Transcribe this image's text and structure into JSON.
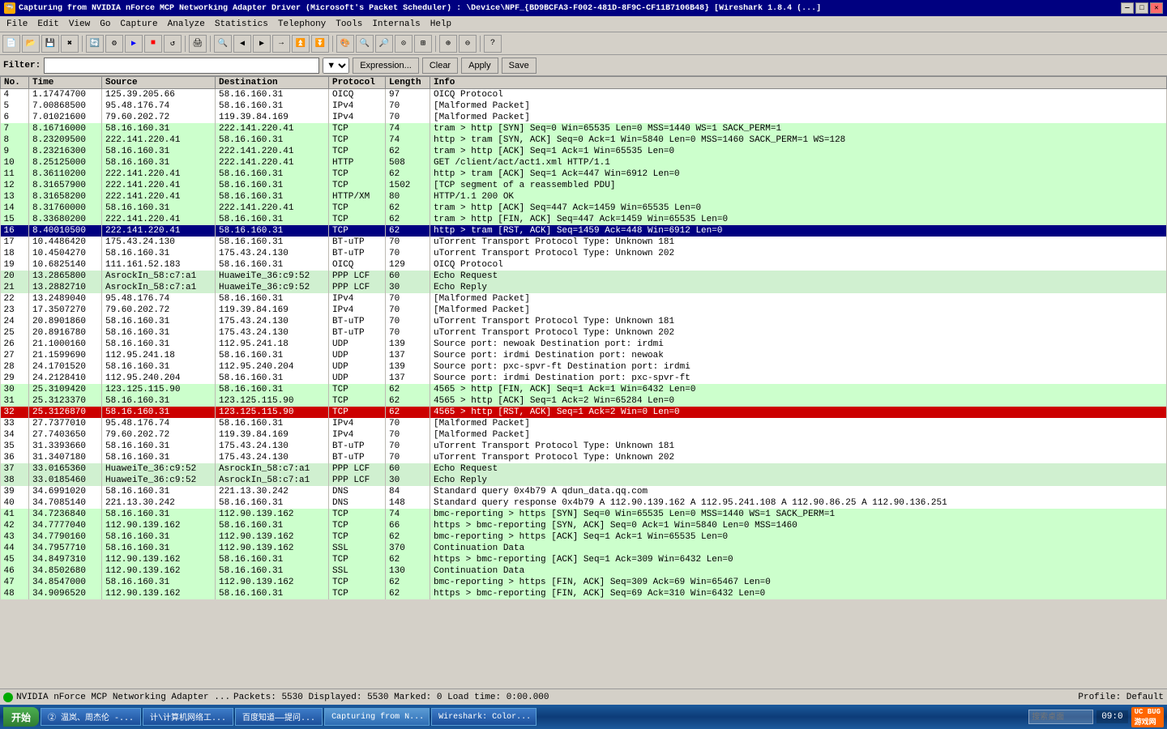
{
  "titlebar": {
    "title": "Capturing from NVIDIA nForce MCP Networking Adapter Driver (Microsoft's Packet Scheduler) : \\Device\\NPF_{BD9BCFA3-F002-481D-8F9C-CF11B7106B48}  [Wireshark 1.8.4 (...]",
    "icon": "🦈",
    "btn_min": "—",
    "btn_max": "□",
    "btn_close": "✕"
  },
  "menubar": {
    "items": [
      "File",
      "Edit",
      "View",
      "Go",
      "Capture",
      "Analyze",
      "Statistics",
      "Telephony",
      "Tools",
      "Internals",
      "Help"
    ]
  },
  "filterbar": {
    "label": "Filter:",
    "placeholder": "",
    "expression_btn": "Expression...",
    "clear_btn": "Clear",
    "apply_btn": "Apply",
    "save_btn": "Save"
  },
  "columns": [
    "No.",
    "Time",
    "Source",
    "Destination",
    "Protocol",
    "Length",
    "Info"
  ],
  "packets": [
    {
      "no": "4",
      "time": "1.17474700",
      "src": "125.39.205.66",
      "dst": "58.16.160.31",
      "proto": "OICQ",
      "len": "97",
      "info": "OICQ Protocol",
      "color": "white"
    },
    {
      "no": "5",
      "time": "7.00868500",
      "src": "95.48.176.74",
      "dst": "58.16.160.31",
      "proto": "IPv4",
      "len": "70",
      "info": "[Malformed Packet]",
      "color": "white"
    },
    {
      "no": "6",
      "time": "7.01021600",
      "src": "79.60.202.72",
      "dst": "119.39.84.169",
      "proto": "IPv4",
      "len": "70",
      "info": "[Malformed Packet]",
      "color": "white"
    },
    {
      "no": "7",
      "time": "8.16716000",
      "src": "58.16.160.31",
      "dst": "222.141.220.41",
      "proto": "TCP",
      "len": "74",
      "info": "tram > http [SYN] Seq=0 Win=65535 Len=0 MSS=1440 WS=1 SACK_PERM=1",
      "color": "green"
    },
    {
      "no": "8",
      "time": "8.23209500",
      "src": "222.141.220.41",
      "dst": "58.16.160.31",
      "proto": "TCP",
      "len": "74",
      "info": "http > tram [SYN, ACK] Seq=0 Ack=1 Win=5840 Len=0 MSS=1460 SACK_PERM=1 WS=128",
      "color": "green"
    },
    {
      "no": "9",
      "time": "8.23216300",
      "src": "58.16.160.31",
      "dst": "222.141.220.41",
      "proto": "TCP",
      "len": "62",
      "info": "tram > http [ACK] Seq=1 Ack=1 Win=65535 Len=0",
      "color": "green"
    },
    {
      "no": "10",
      "time": "8.25125000",
      "src": "58.16.160.31",
      "dst": "222.141.220.41",
      "proto": "HTTP",
      "len": "508",
      "info": "GET /client/act/act1.xml HTTP/1.1",
      "color": "green"
    },
    {
      "no": "11",
      "time": "8.36110200",
      "src": "222.141.220.41",
      "dst": "58.16.160.31",
      "proto": "TCP",
      "len": "62",
      "info": "http > tram [ACK] Seq=1 Ack=447 Win=6912 Len=0",
      "color": "green"
    },
    {
      "no": "12",
      "time": "8.31657900",
      "src": "222.141.220.41",
      "dst": "58.16.160.31",
      "proto": "TCP",
      "len": "1502",
      "info": "[TCP segment of a reassembled PDU]",
      "color": "green"
    },
    {
      "no": "13",
      "time": "8.31658200",
      "src": "222.141.220.41",
      "dst": "58.16.160.31",
      "proto": "HTTP/XM",
      "len": "80",
      "info": "HTTP/1.1 200 OK",
      "color": "green"
    },
    {
      "no": "14",
      "time": "8.31760000",
      "src": "58.16.160.31",
      "dst": "222.141.220.41",
      "proto": "TCP",
      "len": "62",
      "info": "tram > http [ACK] Seq=447 Ack=1459 Win=65535 Len=0",
      "color": "green"
    },
    {
      "no": "15",
      "time": "8.33680200",
      "src": "222.141.220.41",
      "dst": "58.16.160.31",
      "proto": "TCP",
      "len": "62",
      "info": "tram > http [FIN, ACK] Seq=447 Ack=1459 Win=65535 Len=0",
      "color": "green"
    },
    {
      "no": "16",
      "time": "8.40010500",
      "src": "222.141.220.41",
      "dst": "58.16.160.31",
      "proto": "TCP",
      "len": "62",
      "info": "http > tram [RST, ACK] Seq=1459 Ack=448 Win=6912 Len=0",
      "color": "selected"
    },
    {
      "no": "17",
      "time": "10.4486420",
      "src": "175.43.24.130",
      "dst": "58.16.160.31",
      "proto": "BT-uTP",
      "len": "70",
      "info": "uTorrent Transport Protocol Type: Unknown 181",
      "color": "white"
    },
    {
      "no": "18",
      "time": "10.4504270",
      "src": "58.16.160.31",
      "dst": "175.43.24.130",
      "proto": "BT-uTP",
      "len": "70",
      "info": "uTorrent Transport Protocol Type: Unknown 202",
      "color": "white"
    },
    {
      "no": "19",
      "time": "10.6825140",
      "src": "111.161.52.183",
      "dst": "58.16.160.31",
      "proto": "OICQ",
      "len": "129",
      "info": "OICQ Protocol",
      "color": "white"
    },
    {
      "no": "20",
      "time": "13.2865800",
      "src": "AsrockIn_58:c7:a1",
      "dst": "HuaweiTe_36:c9:52",
      "proto": "PPP LCF",
      "len": "60",
      "info": "Echo Request",
      "color": "lightgreen"
    },
    {
      "no": "21",
      "time": "13.2882710",
      "src": "AsrockIn_58:c7:a1",
      "dst": "HuaweiTe_36:c9:52",
      "proto": "PPP LCF",
      "len": "30",
      "info": "Echo Reply",
      "color": "lightgreen"
    },
    {
      "no": "22",
      "time": "13.2489040",
      "src": "95.48.176.74",
      "dst": "58.16.160.31",
      "proto": "IPv4",
      "len": "70",
      "info": "[Malformed Packet]",
      "color": "white"
    },
    {
      "no": "23",
      "time": "17.3507270",
      "src": "79.60.202.72",
      "dst": "119.39.84.169",
      "proto": "IPv4",
      "len": "70",
      "info": "[Malformed Packet]",
      "color": "white"
    },
    {
      "no": "24",
      "time": "20.8901860",
      "src": "58.16.160.31",
      "dst": "175.43.24.130",
      "proto": "BT-uTP",
      "len": "70",
      "info": "uTorrent Transport Protocol Type: Unknown 181",
      "color": "white"
    },
    {
      "no": "25",
      "time": "20.8916780",
      "src": "58.16.160.31",
      "dst": "175.43.24.130",
      "proto": "BT-uTP",
      "len": "70",
      "info": "uTorrent Transport Protocol Type: Unknown 202",
      "color": "white"
    },
    {
      "no": "26",
      "time": "21.1000160",
      "src": "58.16.160.31",
      "dst": "112.95.241.18",
      "proto": "UDP",
      "len": "139",
      "info": "Source port: newoak  Destination port: irdmi",
      "color": "white"
    },
    {
      "no": "27",
      "time": "21.1599690",
      "src": "112.95.241.18",
      "dst": "58.16.160.31",
      "proto": "UDP",
      "len": "137",
      "info": "Source port: irdmi  Destination port: newoak",
      "color": "white"
    },
    {
      "no": "28",
      "time": "24.1701520",
      "src": "58.16.160.31",
      "dst": "112.95.240.204",
      "proto": "UDP",
      "len": "139",
      "info": "Source port: pxc-spvr-ft  Destination port: irdmi",
      "color": "white"
    },
    {
      "no": "29",
      "time": "24.2128410",
      "src": "112.95.240.204",
      "dst": "58.16.160.31",
      "proto": "UDP",
      "len": "137",
      "info": "Source port: irdmi  Destination port: pxc-spvr-ft",
      "color": "white"
    },
    {
      "no": "30",
      "time": "25.3109420",
      "src": "123.125.115.90",
      "dst": "58.16.160.31",
      "proto": "TCP",
      "len": "62",
      "info": "4565 > http [FIN, ACK] Seq=1 Ack=1 Win=6432 Len=0",
      "color": "green"
    },
    {
      "no": "31",
      "time": "25.3123370",
      "src": "58.16.160.31",
      "dst": "123.125.115.90",
      "proto": "TCP",
      "len": "62",
      "info": "4565 > http [ACK] Seq=1 Ack=2 Win=65284 Len=0",
      "color": "green"
    },
    {
      "no": "32",
      "time": "25.3126870",
      "src": "58.16.160.31",
      "dst": "123.125.115.90",
      "proto": "TCP",
      "len": "62",
      "info": "4565 > http [RST, ACK] Seq=1 Ack=2 Win=0 Len=0",
      "color": "selected2"
    },
    {
      "no": "33",
      "time": "27.7377010",
      "src": "95.48.176.74",
      "dst": "58.16.160.31",
      "proto": "IPv4",
      "len": "70",
      "info": "[Malformed Packet]",
      "color": "white"
    },
    {
      "no": "34",
      "time": "27.7403650",
      "src": "79.60.202.72",
      "dst": "119.39.84.169",
      "proto": "IPv4",
      "len": "70",
      "info": "[Malformed Packet]",
      "color": "white"
    },
    {
      "no": "35",
      "time": "31.3393660",
      "src": "58.16.160.31",
      "dst": "175.43.24.130",
      "proto": "BT-uTP",
      "len": "70",
      "info": "uTorrent Transport Protocol Type: Unknown 181",
      "color": "white"
    },
    {
      "no": "36",
      "time": "31.3407180",
      "src": "58.16.160.31",
      "dst": "175.43.24.130",
      "proto": "BT-uTP",
      "len": "70",
      "info": "uTorrent Transport Protocol Type: Unknown 202",
      "color": "white"
    },
    {
      "no": "37",
      "time": "33.0165360",
      "src": "HuaweiTe_36:c9:52",
      "dst": "AsrockIn_58:c7:a1",
      "proto": "PPP LCF",
      "len": "60",
      "info": "Echo Request",
      "color": "lightgreen"
    },
    {
      "no": "38",
      "time": "33.0185460",
      "src": "HuaweiTe_36:c9:52",
      "dst": "AsrockIn_58:c7:a1",
      "proto": "PPP LCF",
      "len": "30",
      "info": "Echo Reply",
      "color": "lightgreen"
    },
    {
      "no": "39",
      "time": "34.6991020",
      "src": "58.16.160.31",
      "dst": "221.13.30.242",
      "proto": "DNS",
      "len": "84",
      "info": "Standard query 0x4b79  A qdun_data.qq.com",
      "color": "white"
    },
    {
      "no": "40",
      "time": "34.7085140",
      "src": "221.13.30.242",
      "dst": "58.16.160.31",
      "proto": "DNS",
      "len": "148",
      "info": "Standard query response 0x4b79  A 112.90.139.162 A 112.95.241.108 A 112.90.86.25 A 112.90.136.251",
      "color": "white"
    },
    {
      "no": "41",
      "time": "34.7236840",
      "src": "58.16.160.31",
      "dst": "112.90.139.162",
      "proto": "TCP",
      "len": "74",
      "info": "bmc-reporting > https [SYN] Seq=0 Win=65535 Len=0 MSS=1440 WS=1 SACK_PERM=1",
      "color": "green"
    },
    {
      "no": "42",
      "time": "34.7777040",
      "src": "112.90.139.162",
      "dst": "58.16.160.31",
      "proto": "TCP",
      "len": "66",
      "info": "https > bmc-reporting [SYN, ACK] Seq=0 Ack=1 Win=5840 Len=0 MSS=1460",
      "color": "green"
    },
    {
      "no": "43",
      "time": "34.7790160",
      "src": "58.16.160.31",
      "dst": "112.90.139.162",
      "proto": "TCP",
      "len": "62",
      "info": "bmc-reporting > https [ACK] Seq=1 Ack=1 Win=65535 Len=0",
      "color": "green"
    },
    {
      "no": "44",
      "time": "34.7957710",
      "src": "58.16.160.31",
      "dst": "112.90.139.162",
      "proto": "SSL",
      "len": "370",
      "info": "Continuation Data",
      "color": "green"
    },
    {
      "no": "45",
      "time": "34.8497310",
      "src": "112.90.139.162",
      "dst": "58.16.160.31",
      "proto": "TCP",
      "len": "62",
      "info": "https > bmc-reporting [ACK] Seq=1 Ack=309 Win=6432 Len=0",
      "color": "green"
    },
    {
      "no": "46",
      "time": "34.8502680",
      "src": "112.90.139.162",
      "dst": "58.16.160.31",
      "proto": "SSL",
      "len": "130",
      "info": "Continuation Data",
      "color": "green"
    },
    {
      "no": "47",
      "time": "34.8547000",
      "src": "58.16.160.31",
      "dst": "112.90.139.162",
      "proto": "TCP",
      "len": "62",
      "info": "bmc-reporting > https [FIN, ACK] Seq=309 Ack=69 Win=65467 Len=0",
      "color": "green"
    },
    {
      "no": "48",
      "time": "34.9096520",
      "src": "112.90.139.162",
      "dst": "58.16.160.31",
      "proto": "TCP",
      "len": "62",
      "info": "https > bmc-reporting [FIN, ACK] Seq=69 Ack=310 Win=6432 Len=0",
      "color": "green"
    }
  ],
  "statusbar": {
    "packets_info": "Packets: 5530 Displayed: 5530 Marked: 0 Load time: 0:00.000",
    "profile": "Profile: Default"
  },
  "taskbar": {
    "start_label": "开始",
    "items": [
      {
        "label": "② 温岚、周杰伦 -...",
        "active": false
      },
      {
        "label": "计\\计算机网络工...",
        "active": false
      },
      {
        "label": "百度知道——提问...",
        "active": false
      },
      {
        "label": "Capturing from N...",
        "active": true
      },
      {
        "label": "Wireshark: Color...",
        "active": false
      }
    ],
    "search_placeholder": "搜索桌面",
    "clock": "09:0",
    "corner": "UC BUG 游戏网"
  }
}
